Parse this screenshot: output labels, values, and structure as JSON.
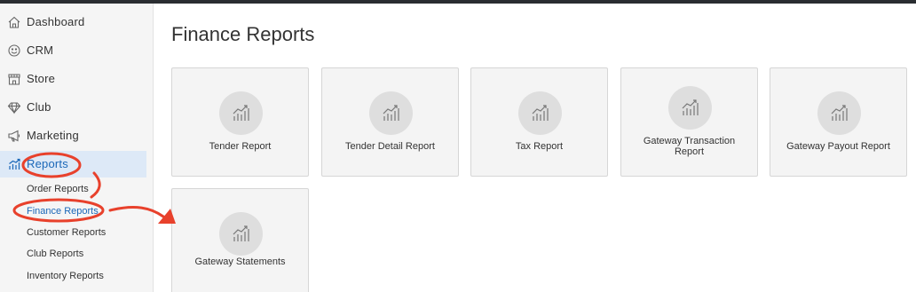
{
  "sidebar": {
    "items": [
      {
        "label": "Dashboard",
        "icon": "home-icon"
      },
      {
        "label": "CRM",
        "icon": "smiley-icon"
      },
      {
        "label": "Store",
        "icon": "store-icon"
      },
      {
        "label": "Club",
        "icon": "diamond-icon"
      },
      {
        "label": "Marketing",
        "icon": "megaphone-icon"
      },
      {
        "label": "Reports",
        "icon": "reports-chart-icon",
        "active": true
      }
    ],
    "sub_items": [
      {
        "label": "Order Reports"
      },
      {
        "label": "Finance Reports",
        "active": true
      },
      {
        "label": "Customer Reports"
      },
      {
        "label": "Club Reports"
      },
      {
        "label": "Inventory Reports"
      }
    ]
  },
  "main": {
    "title": "Finance Reports",
    "cards": [
      {
        "label": "Tender Report"
      },
      {
        "label": "Tender Detail Report"
      },
      {
        "label": "Tax Report"
      },
      {
        "label": "Gateway Transaction Report"
      },
      {
        "label": "Gateway Payout Report"
      },
      {
        "label": "Gateway Statements"
      }
    ]
  },
  "colors": {
    "accent": "#1a67b8",
    "active_bg": "#dde9f7",
    "annotation": "#e8412c",
    "topbar": "#2a2d31"
  }
}
